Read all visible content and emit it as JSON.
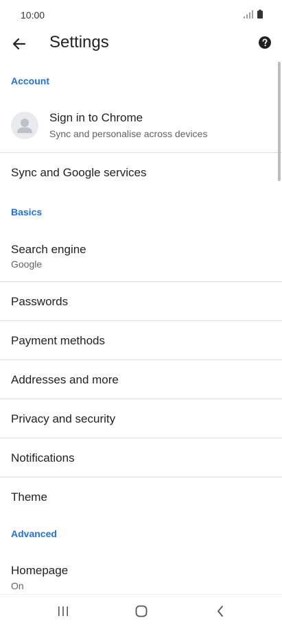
{
  "status_bar": {
    "time": "10:00",
    "icons": [
      "signal-icon",
      "battery-icon"
    ]
  },
  "header": {
    "title": "Settings",
    "back_icon": "back-arrow-icon",
    "help_icon": "help-icon"
  },
  "sections": {
    "account": "Account",
    "basics": "Basics",
    "advanced": "Advanced"
  },
  "account": {
    "sign_in_title": "Sign in to Chrome",
    "sign_in_subtitle": "Sync and personalise across devices",
    "sync_services": "Sync and Google services"
  },
  "basics": {
    "search_engine": {
      "title": "Search engine",
      "value": "Google"
    },
    "passwords": "Passwords",
    "payment_methods": "Payment methods",
    "addresses": "Addresses and more",
    "privacy": "Privacy and security",
    "notifications": "Notifications",
    "theme": "Theme"
  },
  "advanced": {
    "homepage": {
      "title": "Homepage",
      "value": "On"
    }
  },
  "nav_bar": {
    "icons": [
      "recents-icon",
      "home-icon",
      "back-icon"
    ]
  },
  "colors": {
    "accent": "#1a73e8",
    "text_primary": "#202124",
    "text_secondary": "#5f6368",
    "divider": "#dadce0"
  }
}
